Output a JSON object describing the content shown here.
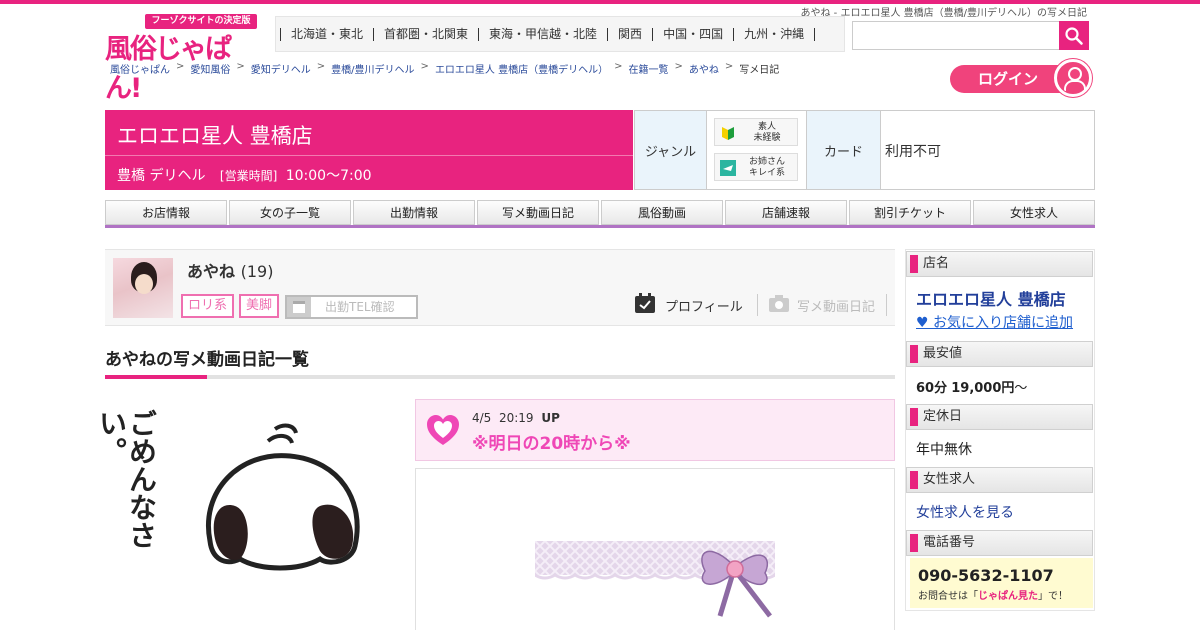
{
  "page_title": "あやね - エロエロ星人 豊橋店（豊橋/豊川デリヘル）の写メ日記",
  "logo": {
    "tagline": "フーゾクサイトの決定版",
    "name": "風俗じゃぱん!"
  },
  "regions": [
    "北海道・東北",
    "首都圏・北関東",
    "東海・甲信越・北陸",
    "関西",
    "中国・四国",
    "九州・沖縄"
  ],
  "search": {
    "placeholder": ""
  },
  "breadcrumbs": [
    "風俗じゃぱん",
    "愛知風俗",
    "愛知デリヘル",
    "豊橋/豊川デリヘル",
    "エロエロ星人 豊橋店（豊橋デリヘル）",
    "在籍一覧",
    "あやね",
    "写メ日記"
  ],
  "login_label": "ログイン",
  "shop": {
    "name": "エロエロ星人 豊橋店",
    "area_genre": "豊橋 デリヘル",
    "hours_label": "[営業時間]",
    "hours": "10:00～7:00"
  },
  "info": {
    "genre_label": "ジャンル",
    "genre_badges": [
      {
        "line1": "素人",
        "line2": "未経験"
      },
      {
        "line1": "お姉さん",
        "line2": "キレイ系"
      }
    ],
    "card_label": "カード",
    "card_value": "利用不可"
  },
  "tabs": [
    "お店情報",
    "女の子一覧",
    "出勤情報",
    "写メ動画日記",
    "風俗動画",
    "店舗速報",
    "割引チケット",
    "女性求人"
  ],
  "profile": {
    "name": "あやね",
    "age": "(19)",
    "tags": [
      "ロリ系",
      "美脚"
    ],
    "tel_button": "出勤TEL確認",
    "profile_link": "プロフィール",
    "diary_link": "写メ動画日記"
  },
  "section_title": "あやねの写メ動画日記一覧",
  "entry": {
    "date": "4/5",
    "time": "20:19",
    "up": "UP",
    "title": "※明日の20時から※",
    "image_text": "ごめんなさい。"
  },
  "sidebar": {
    "shop_label": "店名",
    "shop_name": "エロエロ星人 豊橋店",
    "fav_link": "♥ お気に入り店舗に追加",
    "price_label": "最安値",
    "price_time": "60分",
    "price_value": "19,000円",
    "price_suffix": "～",
    "holiday_label": "定休日",
    "holiday_value": "年中無休",
    "jobs_label": "女性求人",
    "jobs_link": "女性求人を見る",
    "phone_label": "電話番号",
    "phone": "090-5632-1107",
    "phone_note_a": "お問合せは「",
    "phone_note_b": "じゃぱん見た",
    "phone_note_c": "」で！"
  },
  "colors": {
    "brand": "#e8237f",
    "tab_line": "#b073c4",
    "entry_title": "#ef47b6"
  }
}
